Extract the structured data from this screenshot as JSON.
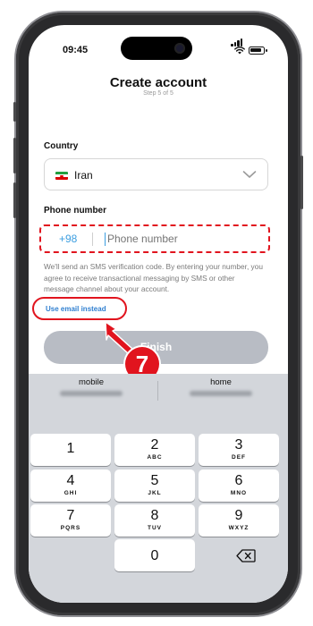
{
  "status_bar": {
    "time": "09:45"
  },
  "header": {
    "title": "Create account",
    "step": "Step 5 of 5"
  },
  "country": {
    "label": "Country",
    "value": "Iran"
  },
  "phone": {
    "label": "Phone number",
    "country_code": "+98",
    "placeholder": "Phone number"
  },
  "disclaimer": "We'll send an SMS verification code. By entering your number, you agree to receive transactional messaging by SMS or other message channel about your account.",
  "email_link": "Use email instead",
  "finish_button": "Finish",
  "annotation": {
    "step_number": "7",
    "color": "#e1141e"
  },
  "keyboard": {
    "suggestions": [
      {
        "label": "mobile"
      },
      {
        "label": "home"
      }
    ],
    "keys": [
      {
        "num": "1",
        "letters": ""
      },
      {
        "num": "2",
        "letters": "ABC"
      },
      {
        "num": "3",
        "letters": "DEF"
      },
      {
        "num": "4",
        "letters": "GHI"
      },
      {
        "num": "5",
        "letters": "JKL"
      },
      {
        "num": "6",
        "letters": "MNO"
      },
      {
        "num": "7",
        "letters": "PQRS"
      },
      {
        "num": "8",
        "letters": "TUV"
      },
      {
        "num": "9",
        "letters": "WXYZ"
      },
      {
        "num": "0",
        "letters": ""
      }
    ]
  },
  "colors": {
    "accent": "#3c9ee0",
    "link": "#2f7fd0",
    "button_disabled": "#b8bcc4",
    "highlight": "#e1141e"
  }
}
